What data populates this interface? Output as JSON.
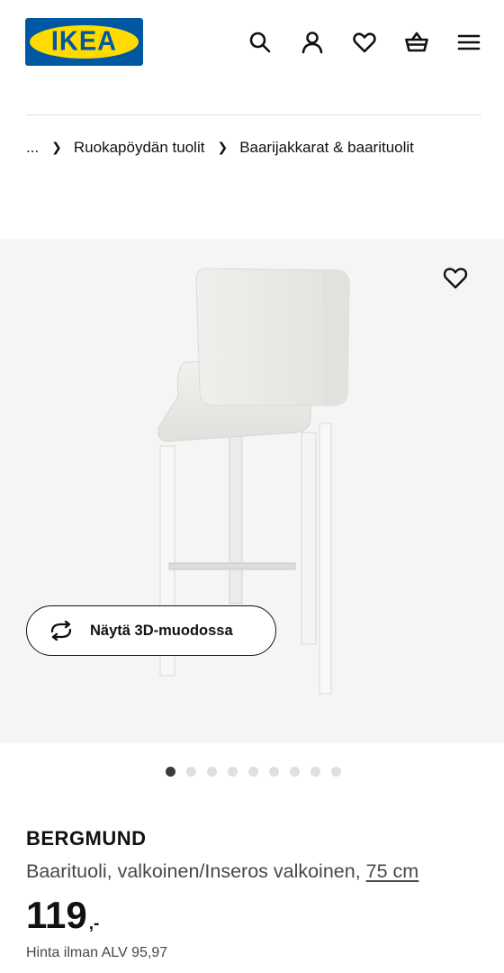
{
  "header": {
    "logo_text": "IKEA",
    "icons": [
      "search-icon",
      "user-icon",
      "heart-icon",
      "basket-icon",
      "menu-icon"
    ]
  },
  "breadcrumb": {
    "ellipsis": "...",
    "items": [
      "Ruokapöydän tuolit",
      "Baarijakkarat & baarituolit"
    ]
  },
  "gallery": {
    "view_3d_label": "Näytä 3D-muodossa",
    "image_count": 9,
    "active_index": 0
  },
  "product": {
    "name": "BERGMUND",
    "description": "Baarituoli, valkoinen/Inseros valkoinen, ",
    "measure": "75 cm",
    "price_integer": "119",
    "price_decimal": ",-",
    "vat_text": "Hinta ilman ALV 95,97"
  },
  "colors": {
    "brand_blue": "#0058a3",
    "brand_yellow": "#ffdb00",
    "text": "#111111",
    "secondary_text": "#484848"
  }
}
